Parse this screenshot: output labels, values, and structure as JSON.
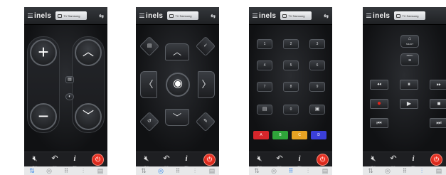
{
  "brand": "inels",
  "device": "TV Samsung",
  "swap_icon": "swap-arrows-icon",
  "actions": {
    "mute": "Mute",
    "exit": "Exit",
    "info": "Info",
    "power_icon": "power-icon"
  },
  "nav_icons": [
    "remote-icon",
    "dpad-icon",
    "numpad-icon",
    "media-icon",
    "extra-icon"
  ],
  "screens": [
    {
      "name": "volume-channel",
      "active_nav": 0
    },
    {
      "name": "dpad",
      "active_nav": 1
    },
    {
      "name": "numpad",
      "active_nav": 2,
      "keys": [
        "1",
        "2",
        "3",
        "4",
        "5",
        "6",
        "7",
        "8",
        "9",
        "",
        "0",
        ""
      ],
      "color_keys": [
        {
          "label": "A",
          "color": "#d6262b"
        },
        {
          "label": "B",
          "color": "#2fa53a"
        },
        {
          "label": "C",
          "color": "#e8a323"
        },
        {
          "label": "D",
          "color": "#3b3fd8"
        }
      ]
    },
    {
      "name": "media",
      "active_nav": 3,
      "smart_label": "SMART",
      "menu_label": "MENU"
    }
  ],
  "colors": {
    "accent_blue": "#2b7de9",
    "power_red": "#e0241a",
    "record_red": "#e0241a"
  }
}
